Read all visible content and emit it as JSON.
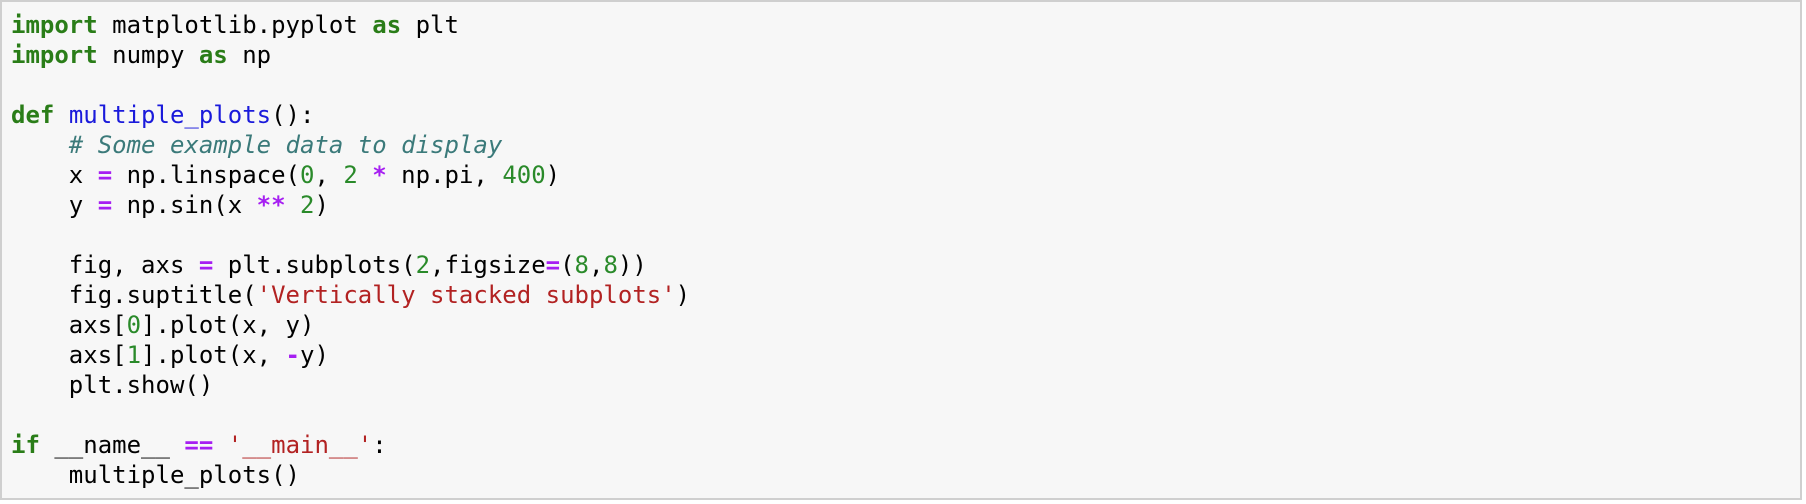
{
  "code_cell": {
    "lines": [
      [
        {
          "t": "import",
          "c": "kw"
        },
        {
          "t": " matplotlib.pyplot ",
          "c": "plain"
        },
        {
          "t": "as",
          "c": "kw"
        },
        {
          "t": " plt",
          "c": "plain"
        }
      ],
      [
        {
          "t": "import",
          "c": "kw"
        },
        {
          "t": " numpy ",
          "c": "plain"
        },
        {
          "t": "as",
          "c": "kw"
        },
        {
          "t": " np",
          "c": "plain"
        }
      ],
      [],
      [
        {
          "t": "def",
          "c": "kw"
        },
        {
          "t": " ",
          "c": "plain"
        },
        {
          "t": "multiple_plots",
          "c": "fn"
        },
        {
          "t": "():",
          "c": "plain"
        }
      ],
      [
        {
          "t": "    ",
          "c": "plain"
        },
        {
          "t": "# Some example data to display",
          "c": "cm"
        }
      ],
      [
        {
          "t": "    x ",
          "c": "plain"
        },
        {
          "t": "=",
          "c": "op"
        },
        {
          "t": " np.linspace(",
          "c": "plain"
        },
        {
          "t": "0",
          "c": "num"
        },
        {
          "t": ", ",
          "c": "plain"
        },
        {
          "t": "2",
          "c": "num"
        },
        {
          "t": " ",
          "c": "plain"
        },
        {
          "t": "*",
          "c": "op"
        },
        {
          "t": " np.pi, ",
          "c": "plain"
        },
        {
          "t": "400",
          "c": "num"
        },
        {
          "t": ")",
          "c": "plain"
        }
      ],
      [
        {
          "t": "    y ",
          "c": "plain"
        },
        {
          "t": "=",
          "c": "op"
        },
        {
          "t": " np.sin(x ",
          "c": "plain"
        },
        {
          "t": "**",
          "c": "op"
        },
        {
          "t": " ",
          "c": "plain"
        },
        {
          "t": "2",
          "c": "num"
        },
        {
          "t": ")",
          "c": "plain"
        }
      ],
      [],
      [
        {
          "t": "    fig, axs ",
          "c": "plain"
        },
        {
          "t": "=",
          "c": "op"
        },
        {
          "t": " plt.subplots(",
          "c": "plain"
        },
        {
          "t": "2",
          "c": "num"
        },
        {
          "t": ",figsize",
          "c": "plain"
        },
        {
          "t": "=",
          "c": "op"
        },
        {
          "t": "(",
          "c": "plain"
        },
        {
          "t": "8",
          "c": "num"
        },
        {
          "t": ",",
          "c": "plain"
        },
        {
          "t": "8",
          "c": "num"
        },
        {
          "t": "))",
          "c": "plain"
        }
      ],
      [
        {
          "t": "    fig.suptitle(",
          "c": "plain"
        },
        {
          "t": "'Vertically stacked subplots'",
          "c": "str"
        },
        {
          "t": ")",
          "c": "plain"
        }
      ],
      [
        {
          "t": "    axs[",
          "c": "plain"
        },
        {
          "t": "0",
          "c": "num"
        },
        {
          "t": "].plot(x, y)",
          "c": "plain"
        }
      ],
      [
        {
          "t": "    axs[",
          "c": "plain"
        },
        {
          "t": "1",
          "c": "num"
        },
        {
          "t": "].plot(x, ",
          "c": "plain"
        },
        {
          "t": "-",
          "c": "op"
        },
        {
          "t": "y)",
          "c": "plain"
        }
      ],
      [
        {
          "t": "    plt.show()",
          "c": "plain"
        }
      ],
      [],
      [
        {
          "t": "if",
          "c": "kw"
        },
        {
          "t": " __name__ ",
          "c": "plain"
        },
        {
          "t": "==",
          "c": "op"
        },
        {
          "t": " ",
          "c": "plain"
        },
        {
          "t": "'__main__'",
          "c": "str"
        },
        {
          "t": ":",
          "c": "plain"
        }
      ],
      [
        {
          "t": "    multiple_plots()",
          "c": "plain"
        }
      ]
    ]
  }
}
